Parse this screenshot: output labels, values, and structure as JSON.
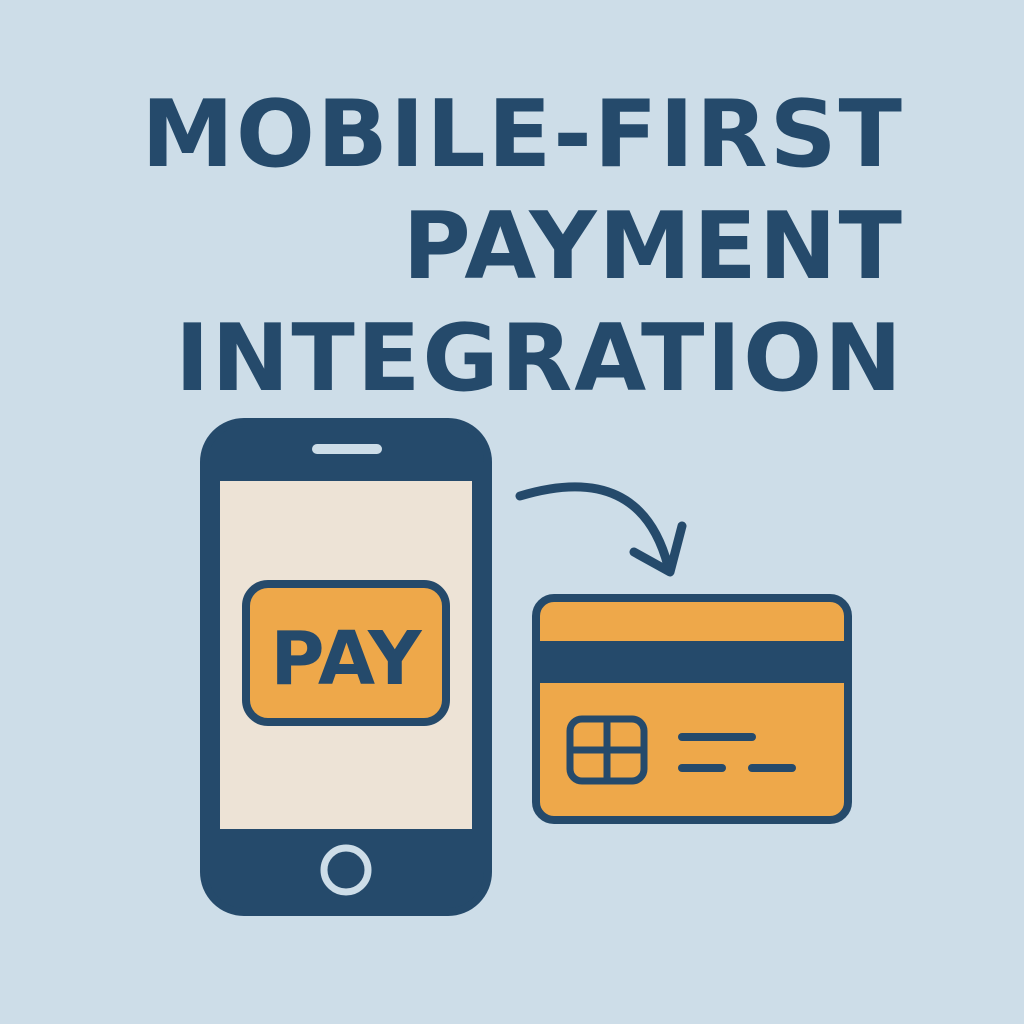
{
  "title": {
    "line1": "MOBILE-FIRST",
    "line2": "PAYMENT",
    "line3": "INTEGRATION"
  },
  "phone": {
    "pay_button_label": "PAY"
  },
  "icons": {
    "phone": "smartphone-icon",
    "arrow": "curved-arrow-icon",
    "card": "credit-card-icon",
    "chip": "card-chip-icon"
  },
  "colors": {
    "background": "#cddde8",
    "navy": "#254a6b",
    "orange": "#eea84a",
    "screen": "#ede3d6"
  }
}
